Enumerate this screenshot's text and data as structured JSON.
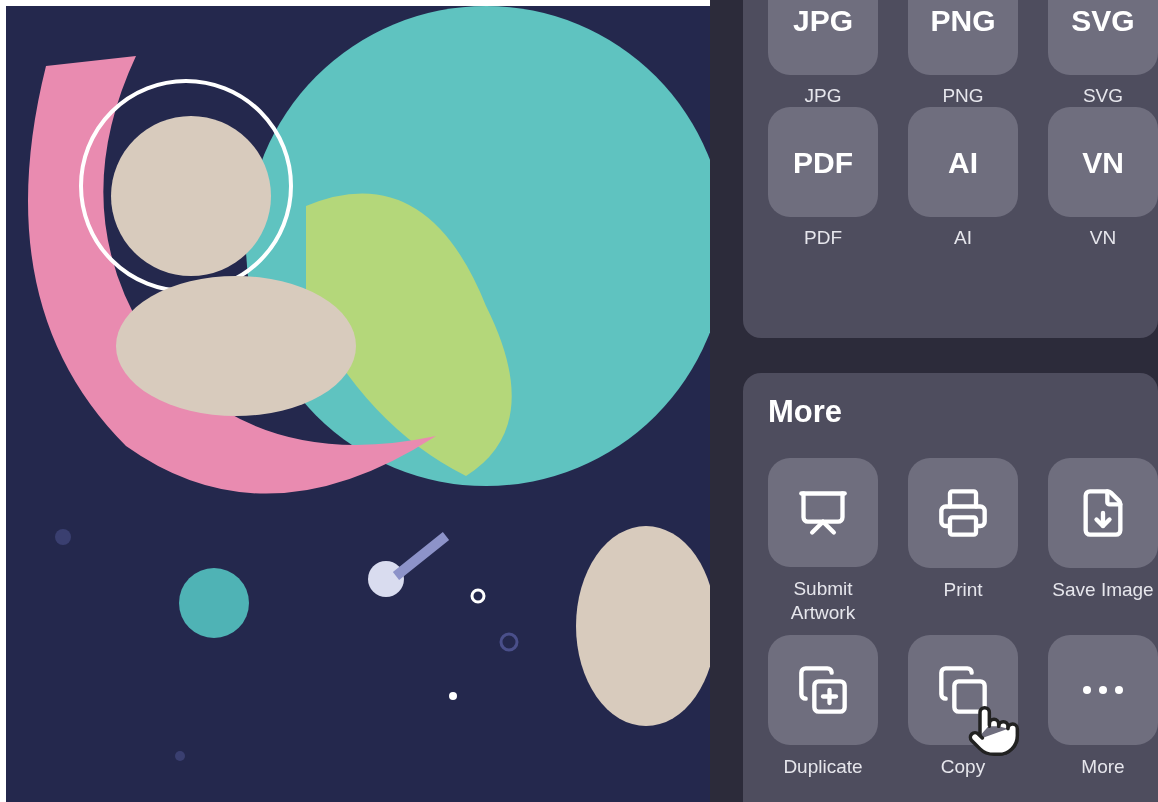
{
  "formats": [
    {
      "badge": "JPG",
      "label": "JPG"
    },
    {
      "badge": "PNG",
      "label": "PNG"
    },
    {
      "badge": "SVG",
      "label": "SVG"
    },
    {
      "badge": "PDF",
      "label": "PDF"
    },
    {
      "badge": "AI",
      "label": "AI"
    },
    {
      "badge": "VN",
      "label": "VN"
    }
  ],
  "more": {
    "title": "More",
    "actions": [
      {
        "kind": "submit",
        "label": "Submit Artwork"
      },
      {
        "kind": "print",
        "label": "Print"
      },
      {
        "kind": "save",
        "label": "Save Image"
      },
      {
        "kind": "duplicate",
        "label": "Duplicate"
      },
      {
        "kind": "copy",
        "label": "Copy"
      },
      {
        "kind": "more",
        "label": "More"
      }
    ]
  }
}
